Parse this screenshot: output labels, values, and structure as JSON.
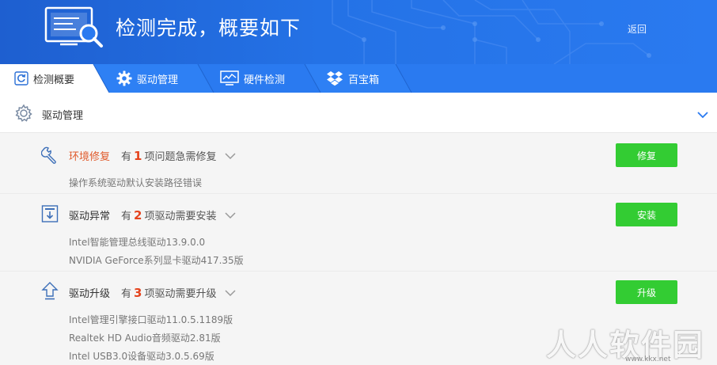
{
  "header": {
    "title": "检测完成，概要如下",
    "back_label": "返回"
  },
  "tabs": [
    {
      "label": "检测概要",
      "icon": "refresh-icon",
      "active": true
    },
    {
      "label": "驱动管理",
      "icon": "gear-icon",
      "active": false
    },
    {
      "label": "硬件检测",
      "icon": "monitor-chart-icon",
      "active": false
    },
    {
      "label": "百宝箱",
      "icon": "dropbox-icon",
      "active": false
    }
  ],
  "section": {
    "title": "驱动管理",
    "icon": "gear-icon"
  },
  "items": [
    {
      "title": "环境修复",
      "prefix": "有",
      "count": "1",
      "suffix": "项问题急需修复",
      "button": "修复",
      "icon": "wrench-icon",
      "details": [
        "操作系统驱动默认安装路径错误"
      ]
    },
    {
      "title": "驱动异常",
      "prefix": "有",
      "count": "2",
      "suffix": "项驱动需要安装",
      "button": "安装",
      "icon": "download-box-icon",
      "details": [
        "Intel智能管理总线驱动13.9.0.0",
        "NVIDIA GeForce系列显卡驱动417.35版"
      ]
    },
    {
      "title": "驱动升级",
      "prefix": "有",
      "count": "3",
      "suffix": "项驱动需要升级",
      "button": "升级",
      "icon": "upload-arrow-icon",
      "details": [
        "Intel管理引擎接口驱动11.0.5.1189版",
        "Realtek HD Audio音频驱动2.81版",
        "Intel USB3.0设备驱动3.0.5.69版"
      ]
    }
  ],
  "watermark": {
    "text": "人人软件园",
    "url": "www.kkx.net"
  },
  "colors": {
    "header_blue": "#2472e6",
    "tab_blue": "#2a7af0",
    "action_green": "#33cc33",
    "count_red": "#e5431d",
    "alert_title": "#e05a2b"
  }
}
